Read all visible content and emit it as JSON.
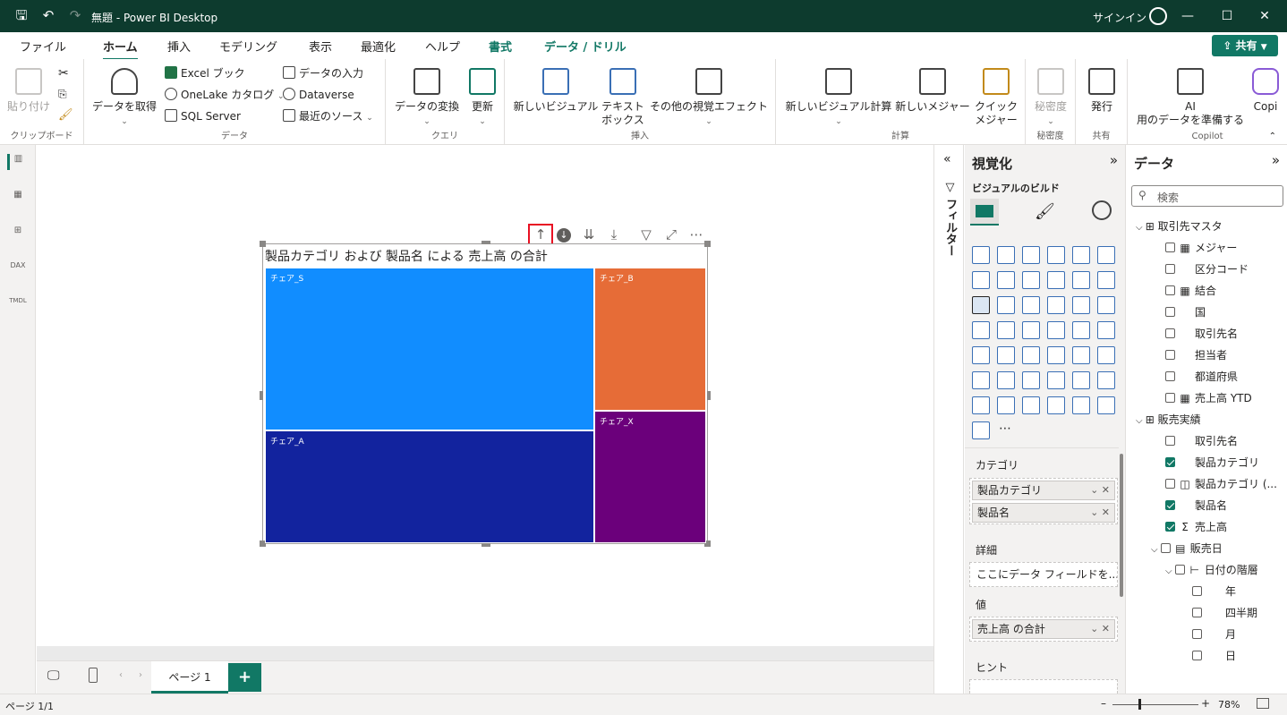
{
  "titlebar": {
    "title": "無題 - Power BI Desktop",
    "signin": "サインイン",
    "icons": [
      "save-icon",
      "undo-icon",
      "redo-icon"
    ],
    "window_controls": [
      "minimize",
      "maximize",
      "close"
    ]
  },
  "tabs": [
    {
      "label": "ファイル"
    },
    {
      "label": "ホーム",
      "active": true
    },
    {
      "label": "挿入"
    },
    {
      "label": "モデリング"
    },
    {
      "label": "表示"
    },
    {
      "label": "最適化"
    },
    {
      "label": "ヘルプ"
    },
    {
      "label": "書式",
      "contextual": true
    },
    {
      "label": "データ / ドリル",
      "contextual": true
    }
  ],
  "share_label": "共有",
  "ribbon": {
    "clipboard": {
      "group": "クリップボード",
      "paste": "貼り付け"
    },
    "data": {
      "group": "データ",
      "get_data_1": "データを取得",
      "excel": "Excel ブック",
      "onelake": "OneLake カタログ",
      "sql": "SQL Server",
      "enter_data": "データの入力",
      "dataverse": "Dataverse",
      "recent": "最近のソース"
    },
    "query": {
      "group": "クエリ",
      "transform": "データの変換",
      "refresh": "更新"
    },
    "insert": {
      "group": "挿入",
      "new_visual": "新しいビジュアル",
      "textbox_1": "テキスト",
      "textbox_2": "ボックス",
      "more_visuals": "その他の視覚エフェクト"
    },
    "calc": {
      "group": "計算",
      "new_visual_calc": "新しいビジュアル計算",
      "new_measure": "新しいメジャー",
      "quick_measure_1": "クイック",
      "quick_measure_2": "メジャー"
    },
    "sensitivity": {
      "group": "秘密度",
      "label": "秘密度"
    },
    "share": {
      "group": "共有",
      "publish": "発行"
    },
    "copilot": {
      "group": "Copilot",
      "ai_1": "AI",
      "ai_2": "用のデータを準備する",
      "copilot": "Copi"
    }
  },
  "visual": {
    "title": "製品カテゴリ および 製品名 による 売上高 の合計",
    "tiles": [
      {
        "label": "チェア_S",
        "color": "#118dff"
      },
      {
        "label": "チェア_B",
        "color": "#e66c37"
      },
      {
        "label": "チェア_A",
        "color": "#12239e"
      },
      {
        "label": "チェア_X",
        "color": "#6b007b"
      }
    ],
    "toolbar_icons": [
      "drill-up-icon",
      "drill-down-on-icon",
      "next-level-icon",
      "expand-hierarchy-icon",
      "filter-icon",
      "focus-mode-icon",
      "more-options-icon"
    ]
  },
  "filters_label": "フィルター",
  "viz_pane": {
    "title": "視覚化",
    "subtitle": "ビジュアルのビルド",
    "wells": [
      {
        "title": "カテゴリ",
        "fields": [
          "製品カテゴリ",
          "製品名"
        ]
      },
      {
        "title": "詳細",
        "placeholder": "ここにデータ フィールドを..."
      },
      {
        "title": "値",
        "fields": [
          "売上高 の合計"
        ]
      },
      {
        "title": "ヒント"
      }
    ]
  },
  "data_pane": {
    "title": "データ",
    "search_placeholder": "検索",
    "tree": [
      {
        "label": "取引先マスタ",
        "level": 0,
        "type": "table",
        "expanded": true
      },
      {
        "label": "メジャー",
        "level": 1,
        "checked": false,
        "icon": "calc"
      },
      {
        "label": "区分コード",
        "level": 1,
        "checked": false
      },
      {
        "label": "結合",
        "level": 1,
        "checked": false,
        "icon": "calc"
      },
      {
        "label": "国",
        "level": 1,
        "checked": false
      },
      {
        "label": "取引先名",
        "level": 1,
        "checked": false
      },
      {
        "label": "担当者",
        "level": 1,
        "checked": false
      },
      {
        "label": "都道府県",
        "level": 1,
        "checked": false
      },
      {
        "label": "売上高 YTD",
        "level": 1,
        "checked": false,
        "icon": "calc"
      },
      {
        "label": "販売実績",
        "level": 0,
        "type": "table",
        "expanded": true
      },
      {
        "label": "取引先名",
        "level": 1,
        "checked": false
      },
      {
        "label": "製品カテゴリ",
        "level": 1,
        "checked": true
      },
      {
        "label": "製品カテゴリ (...",
        "level": 1,
        "checked": false,
        "icon": "group"
      },
      {
        "label": "製品名",
        "level": 1,
        "checked": true
      },
      {
        "label": "売上高",
        "level": 1,
        "checked": true,
        "icon": "sigma"
      },
      {
        "label": "販売日",
        "level": 1,
        "checked": false,
        "icon": "calendar",
        "expanded": true
      },
      {
        "label": "日付の階層",
        "level": 2,
        "checked": false,
        "icon": "hierarchy",
        "expanded": true
      },
      {
        "label": "年",
        "level": 3,
        "checked": false
      },
      {
        "label": "四半期",
        "level": 3,
        "checked": false
      },
      {
        "label": "月",
        "level": 3,
        "checked": false
      },
      {
        "label": "日",
        "level": 3,
        "checked": false
      }
    ]
  },
  "pagebar": {
    "page_tab": "ページ 1",
    "add_label": "+"
  },
  "status": {
    "page": "ページ 1/1",
    "zoom": "78%"
  }
}
